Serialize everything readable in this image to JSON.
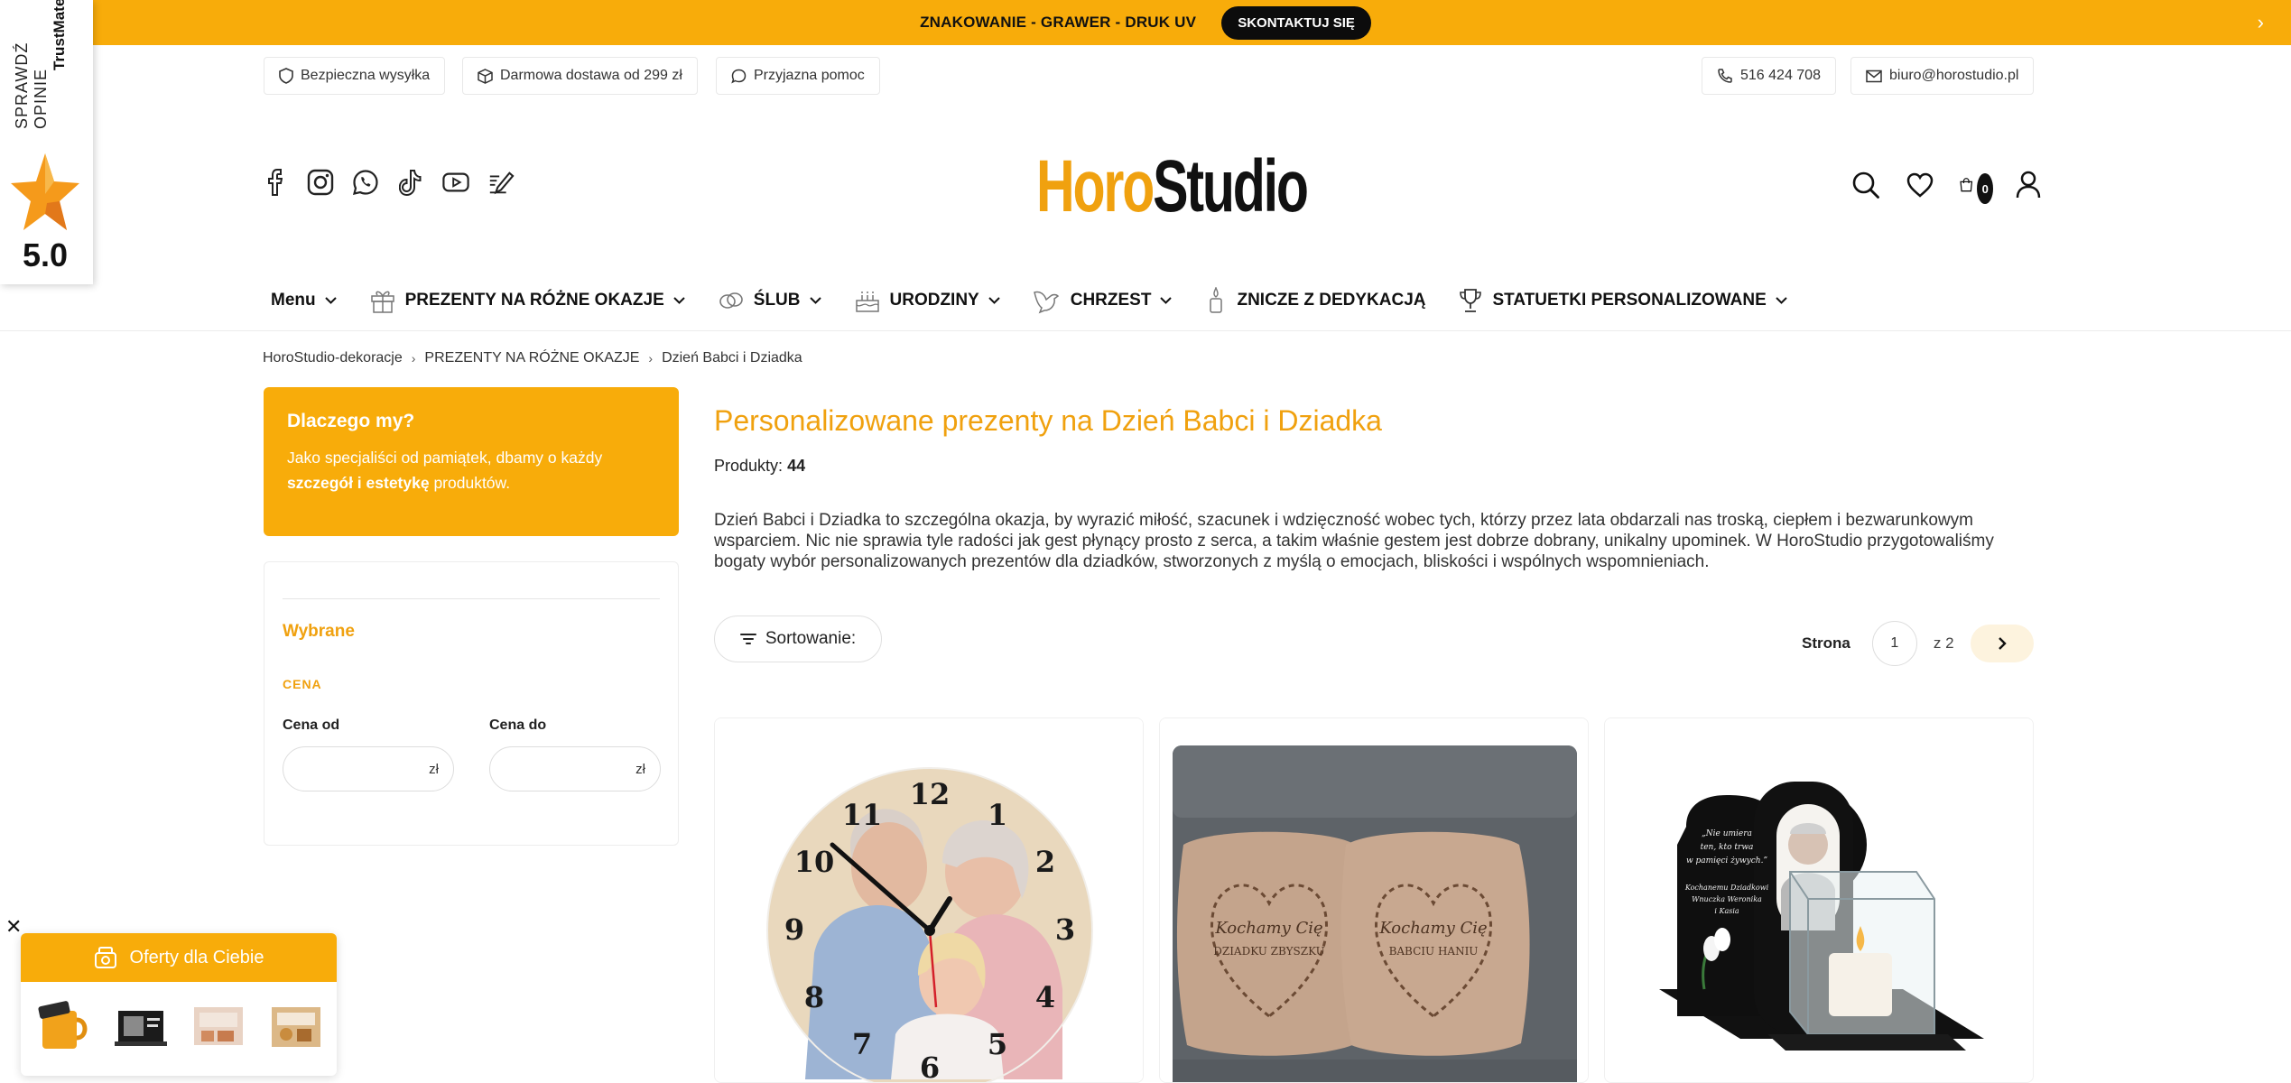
{
  "banner": {
    "promo": "ZNAKOWANIE - GRAWER - DRUK UV",
    "cta": "SKONTAKTUJ SIĘ",
    "next_arrow": "›"
  },
  "trust_widget": {
    "vertical_text": "SPRAWDŹ OPINIE",
    "brand": "TrustMate",
    "score": "5.0"
  },
  "info": {
    "shipping": "Bezpieczna wysyłka",
    "free_delivery": "Darmowa dostawa od 299 zł",
    "help": "Przyjazna pomoc",
    "phone": "516 424 708",
    "email": "biuro@horostudio.pl"
  },
  "social_icons": [
    "facebook-icon",
    "instagram-icon",
    "whatsapp-icon",
    "tiktok-icon",
    "youtube-icon",
    "blog-icon"
  ],
  "logo": {
    "part1": "Horo",
    "part2": "Studio"
  },
  "header_icons": {
    "cart_count": "0"
  },
  "nav": {
    "menu": "Menu",
    "gifts": "PREZENTY NA RÓŻNE OKAZJE",
    "wedding": "ŚLUB",
    "birthday": "URODZINY",
    "baptism": "CHRZEST",
    "candles": "ZNICZE Z DEDYKACJĄ",
    "statuettes": "STATUETKI PERSONALIZOWANE"
  },
  "breadcrumb": [
    "HoroStudio-dekoracje",
    "PREZENTY NA RÓŻNE OKAZJE",
    "Dzień Babci i Dziadka"
  ],
  "sidebar": {
    "why_title": "Dlaczego my?",
    "why_text_1": "Jako specjaliści od pamiątek, dbamy o każdy",
    "why_text_bold": "szczegół i estetykę",
    "why_text_2": " produktów.",
    "selected": "Wybrane",
    "price_section": "CENA",
    "price_from": "Cena od",
    "price_to": "Cena do",
    "currency": "zł"
  },
  "main": {
    "title": "Personalizowane prezenty na Dzień Babci i Dziadka",
    "products_label": "Produkty:",
    "products_count": "44",
    "description": "Dzień Babci i Dziadka to szczególna okazja, by wyrazić miłość, szacunek i wdzięczność wobec tych, którzy przez lata obdarzali nas troską, ciepłem i bezwarunkowym wsparciem. Nic nie sprawia tyle radości jak gest płynący prosto z serca, a takim właśnie gestem jest dobrze dobrany, unikalny upominek. W HoroStudio przygotowaliśmy bogaty wybór personalizowanych prezentów dla dziadków, stworzonych z myślą o emocjach, bliskości i wspólnych wspomnieniach.",
    "sort_label": "Sortowanie:",
    "page_label": "Strona",
    "page_current": "1",
    "page_of": "z 2"
  },
  "products": [
    {
      "name": "clock-product",
      "numbers": [
        "12",
        "1",
        "2",
        "3",
        "4",
        "5",
        "6",
        "7",
        "8",
        "9",
        "10",
        "11"
      ]
    },
    {
      "name": "pillows-product",
      "line1": "Kochamy Cię",
      "pillow_a": "DZIADKU ZBYSZKU",
      "pillow_b": "BABCIU HANIU"
    },
    {
      "name": "memorial-product",
      "lines": [
        "„Nie umiera",
        "ten, kto trwa",
        "w pamięci żywych.”",
        "Kochanemu Dziadkowi",
        "Wnuczka Weronika",
        "i Kasia"
      ]
    }
  ],
  "offers": {
    "title": "Oferty dla Ciebie"
  },
  "colors": {
    "accent": "#f8ac0a",
    "accent_text": "#f0a10f",
    "dark": "#0c0c0c"
  }
}
